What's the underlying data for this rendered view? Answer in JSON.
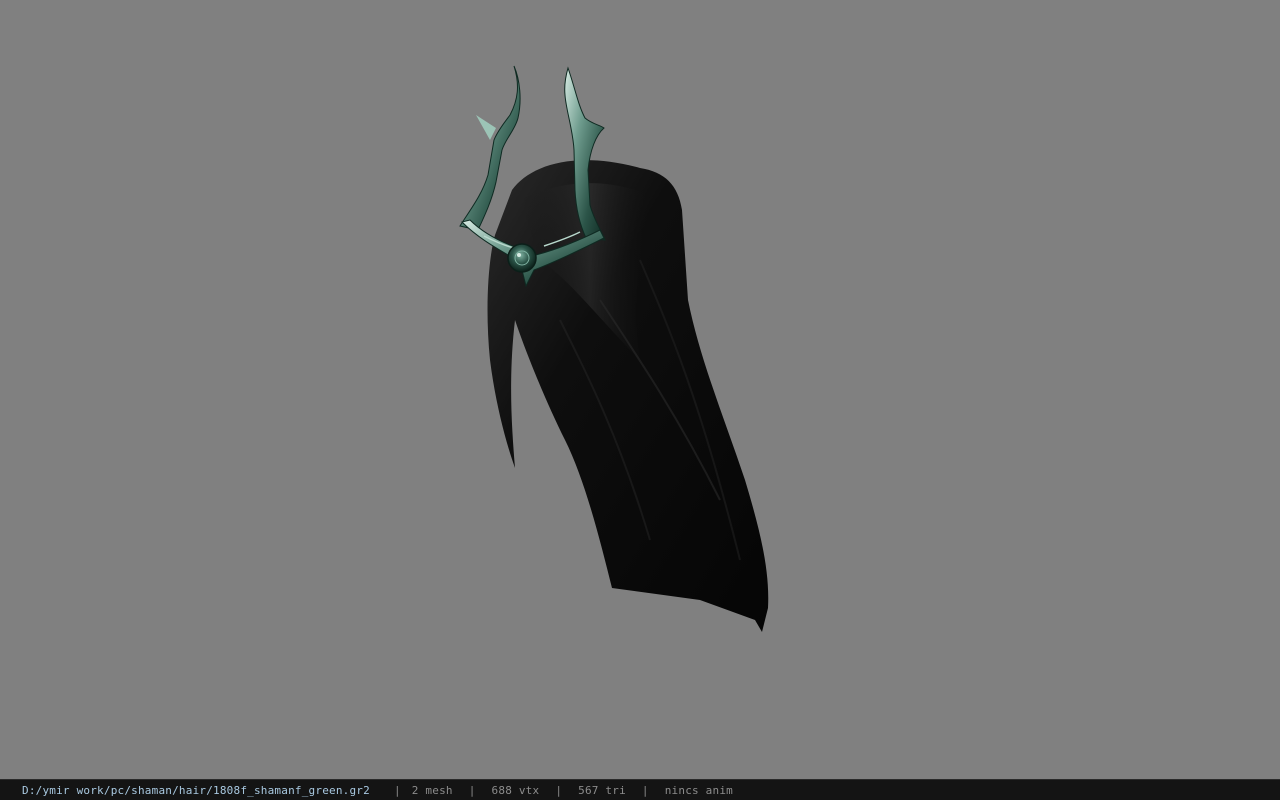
{
  "viewport": {
    "background": "#808080",
    "model_description_icon": "hair-with-horned-circlet-model"
  },
  "statusbar": {
    "file_path": "D:/ymir work/pc/shaman/hair/1808f_shamanf_green.gr2",
    "separator": "|",
    "mesh_count": "2 mesh",
    "vertex_count": "688 vtx",
    "triangle_count": "567 tri",
    "anim_info": "nincs anim"
  },
  "colors": {
    "hair": "#0b0b0b",
    "circlet_metal": "#2f5a4e",
    "circlet_highlight": "#cfe6dc",
    "status_bg": "#141414",
    "path_text": "#a8c8e0"
  }
}
